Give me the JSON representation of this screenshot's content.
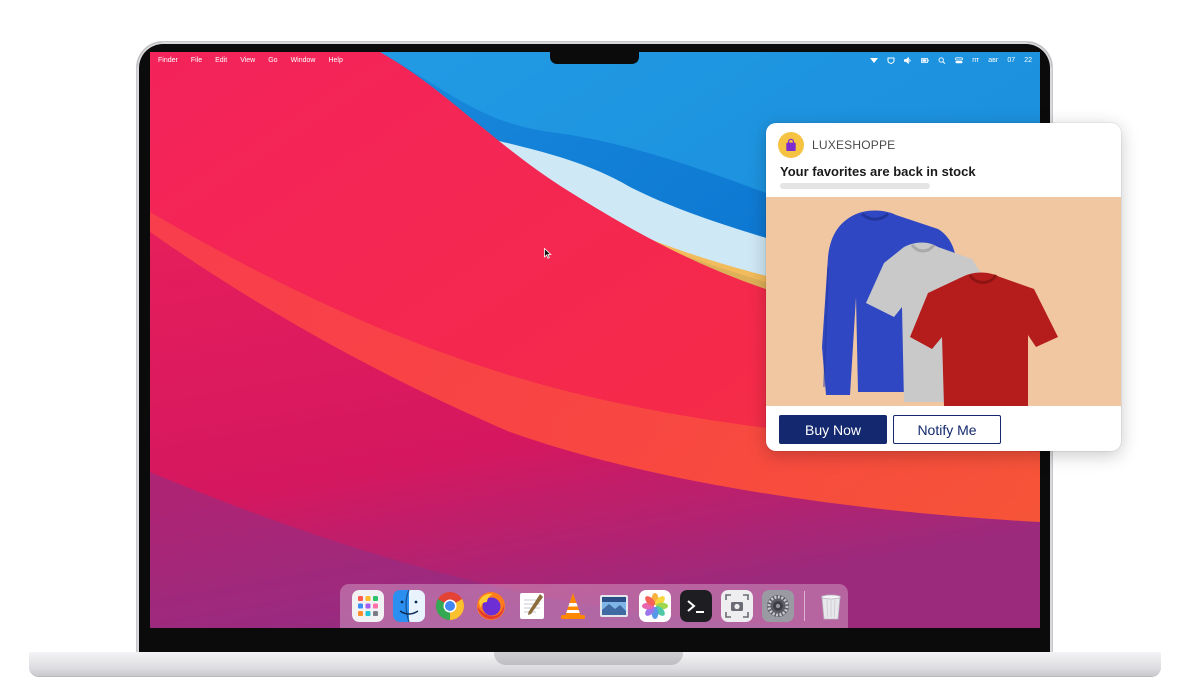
{
  "menubar": {
    "items": [
      "Finder",
      "File",
      "Edit",
      "View",
      "Go",
      "Window",
      "Help"
    ],
    "clock_day": "пт",
    "clock_month": "авг",
    "clock_date": "07",
    "clock_time": "22"
  },
  "dock": {
    "apps": [
      {
        "name": "launchpad",
        "icon": "grid-icon"
      },
      {
        "name": "finder",
        "icon": "finder-icon"
      },
      {
        "name": "chrome",
        "icon": "chrome-icon"
      },
      {
        "name": "firefox",
        "icon": "firefox-icon"
      },
      {
        "name": "textedit",
        "icon": "notepad-icon"
      },
      {
        "name": "vlc",
        "icon": "traffic-cone-icon"
      },
      {
        "name": "preview",
        "icon": "photo-preview-icon"
      },
      {
        "name": "photos",
        "icon": "photos-flower-icon"
      },
      {
        "name": "terminal",
        "icon": "terminal-icon"
      },
      {
        "name": "screenshot",
        "icon": "camera-icon"
      },
      {
        "name": "system-preferences",
        "icon": "gear-icon"
      },
      {
        "name": "trash",
        "icon": "trash-icon"
      }
    ]
  },
  "notification": {
    "brand": "LUXESHOPPE",
    "title": "Your favorites are back in stock",
    "buy_label": "Buy Now",
    "notify_label": "Notify Me",
    "colors": {
      "primary": "#13286f",
      "image_bg": "#f0c7a0",
      "brand_logo": "#f5c242",
      "brand_bag": "#7d2bd1"
    },
    "products": [
      {
        "item": "long-sleeve-tshirt",
        "color": "#2f47c2"
      },
      {
        "item": "tshirt",
        "color": "#c9c9c9"
      },
      {
        "item": "tshirt",
        "color": "#b51c1c"
      }
    ]
  }
}
